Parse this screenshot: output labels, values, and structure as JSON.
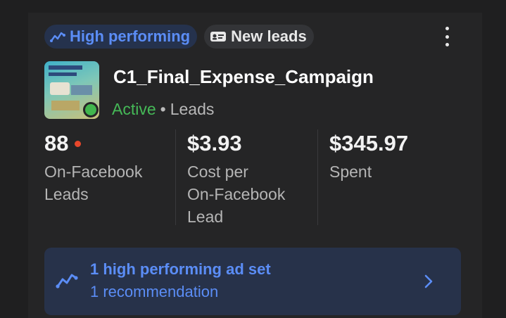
{
  "badges": {
    "high_performing": "High performing",
    "new_leads": "New leads"
  },
  "campaign": {
    "name": "C1_Final_Expense_Campaign",
    "status": "Active",
    "separator": "•",
    "objective": "Leads"
  },
  "metrics": [
    {
      "value": "88",
      "label_lines": [
        "On-Facebook",
        "Leads"
      ]
    },
    {
      "value": "$3.93",
      "label_lines": [
        "Cost per",
        "On-Facebook",
        "Lead"
      ]
    },
    {
      "value": "$345.97",
      "label_lines": [
        "Spent"
      ]
    }
  ],
  "recommendation": {
    "title": "1 high performing ad set",
    "subtitle": "1 recommendation"
  },
  "colors": {
    "accent_blue": "#5b8df6",
    "active_green": "#45b957",
    "alert_red": "#e8472b"
  },
  "icons": {
    "high_performing": "trend-line-icon",
    "new_leads": "lead-card-icon",
    "more": "more-vertical-icon",
    "recommendation": "trend-line-icon",
    "chevron": "chevron-right-icon"
  }
}
